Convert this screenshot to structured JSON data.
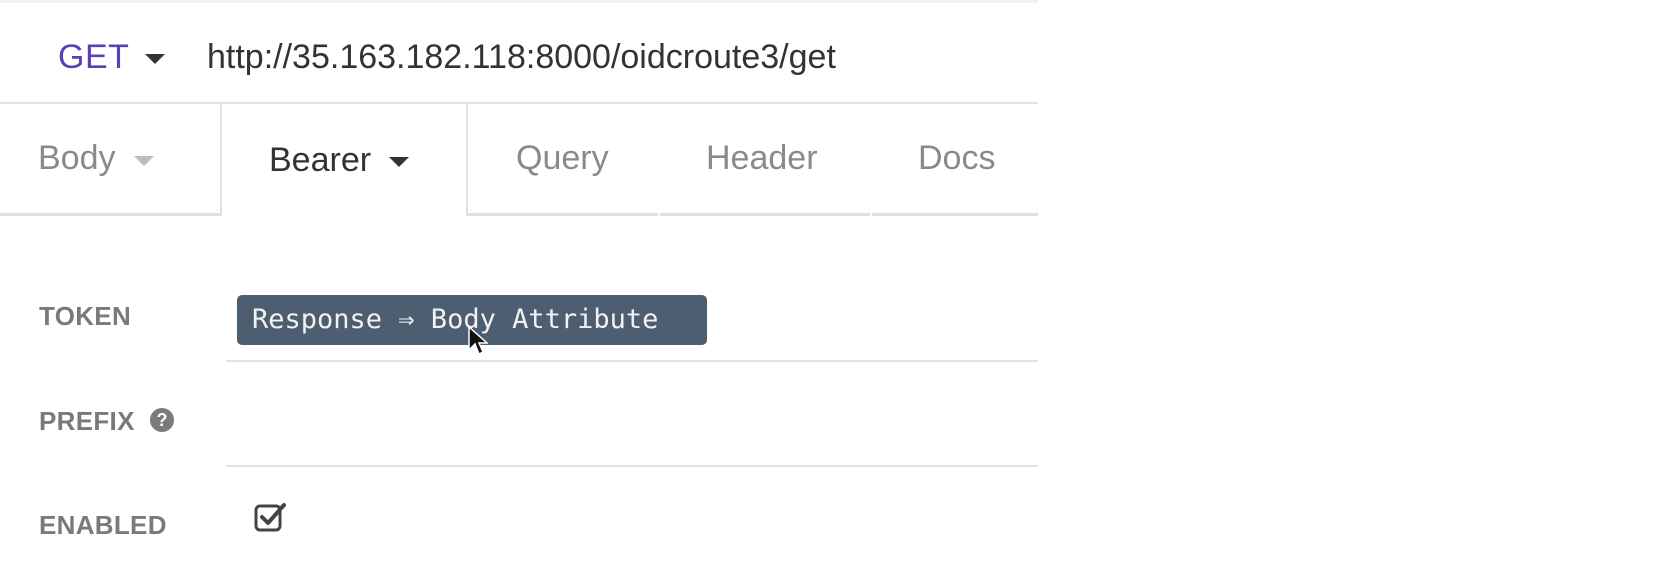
{
  "request": {
    "method": "GET",
    "url": "http://35.163.182.118:8000/oidcroute3/get"
  },
  "tabs": [
    {
      "label": "Body"
    },
    {
      "label": "Bearer"
    },
    {
      "label": "Query"
    },
    {
      "label": "Header"
    },
    {
      "label": "Docs"
    }
  ],
  "auth": {
    "token_label": "TOKEN",
    "token_value": "Response ⇒ Body Attribute",
    "prefix_label": "PREFIX",
    "prefix_value": "",
    "enabled_label": "ENABLED",
    "enabled": true
  },
  "colors": {
    "method": "#5a3fb5",
    "token_pill": "#4d5e70"
  },
  "icons": {
    "method_caret": "chevron-down-icon",
    "help": "question-circle-icon",
    "enabled_checkbox": "checkbox-checked-icon",
    "cursor": "mouse-pointer-icon"
  }
}
